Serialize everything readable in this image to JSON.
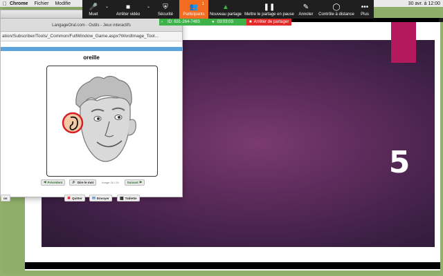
{
  "menubar": {
    "app": "Chrome",
    "items": [
      "Fichier",
      "Modifie"
    ],
    "datetime": "30 avr. à 12:00"
  },
  "zoom_toolbar": {
    "items": [
      {
        "label": "Muet",
        "icon": "microphone-icon"
      },
      {
        "label": "Arrêter vidéo",
        "icon": "video-camera-icon"
      },
      {
        "label": "Sécurité",
        "icon": "shield-icon"
      },
      {
        "label": "Participants",
        "icon": "participants-icon",
        "badge": "1"
      },
      {
        "label": "Nouveau partage",
        "icon": "share-screen-icon"
      },
      {
        "label": "Mettre le partage en pause",
        "icon": "pause-icon"
      },
      {
        "label": "Annoter",
        "icon": "pencil-icon"
      },
      {
        "label": "Contrôle à distance",
        "icon": "mouse-icon"
      },
      {
        "label": "Plus",
        "icon": "more-icon"
      }
    ]
  },
  "meeting_bar": {
    "meeting_id": "ID: 631-264-7493",
    "timer": "03:03:03",
    "stop_share": "Arrêter de partager"
  },
  "browser": {
    "window_title": "LangageOral.com - Outils - Jeux interactifs",
    "url": "ation/Subscriber/Tools/_Common/FullWindow_Game.aspx?WordImage_Tool...",
    "word": "oreille",
    "nav": {
      "previous": "Précédent",
      "say_word": "Dire le mot",
      "counter": "Image 16 / 24",
      "next": "Suivant"
    },
    "bottom": {
      "left_partial": "on",
      "quit": "Quitter",
      "send": "Envoyer",
      "tablet": "Tablette"
    }
  },
  "slide": {
    "number": "5"
  },
  "colors": {
    "frame": "#93b06e",
    "zoom_bg": "#1f1f1f",
    "participants_active": "#f26d21",
    "meeting_green": "#3db34a",
    "stop_red": "#e12a2a",
    "slide_purple": "#5a2a59",
    "accent_pink": "#b5195d"
  }
}
